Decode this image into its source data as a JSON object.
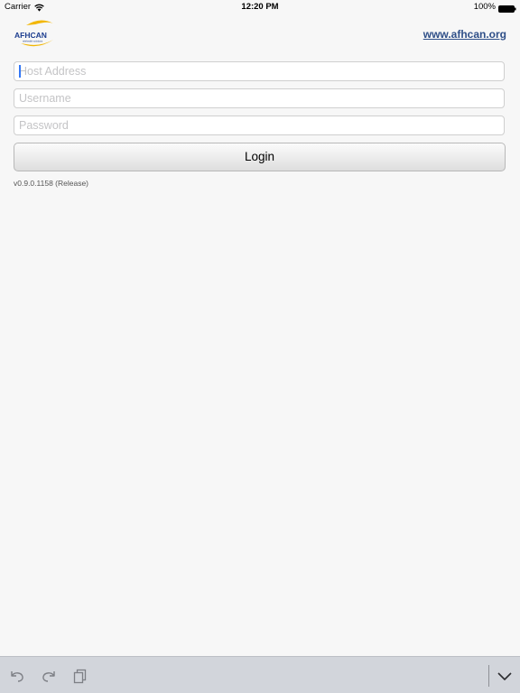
{
  "status_bar": {
    "carrier": "Carrier",
    "time": "12:20 PM",
    "battery": "100%"
  },
  "header": {
    "logo_text": "AFHCAN",
    "logo_subtext": "telehealth solutions",
    "site_link": "www.afhcan.org"
  },
  "form": {
    "host": {
      "value": "",
      "placeholder": "Host Address"
    },
    "username": {
      "value": "",
      "placeholder": "Username"
    },
    "password": {
      "value": "",
      "placeholder": "Password"
    },
    "login_label": "Login"
  },
  "footer": {
    "version": "v0.9.0.1158 (Release)"
  },
  "accessory_bar": {
    "icons": [
      "undo-icon",
      "redo-icon",
      "paste-icon",
      "keyboard-dismiss-icon"
    ]
  },
  "colors": {
    "link": "#2f4f88",
    "caret": "#3478f6",
    "logo_blue": "#1c3d8f",
    "logo_gold": "#f2b705",
    "accessory_bar": "#d2d5db"
  }
}
